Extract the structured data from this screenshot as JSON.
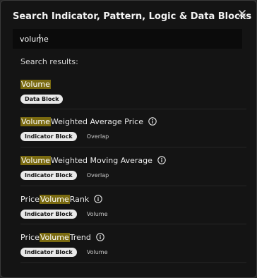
{
  "modal": {
    "title": "Search Indicator, Pattern, Logic & Data Blocks",
    "close_icon": "close-icon"
  },
  "search": {
    "value": "volume",
    "placeholder": ""
  },
  "results_label": "Search results:",
  "highlight_color": "#7a6a10",
  "results": [
    {
      "pre": "",
      "match": "Volume",
      "post": "",
      "info": false,
      "badge": "Data Block",
      "meta": ""
    },
    {
      "pre": "",
      "match": "Volume",
      "post": " Weighted Average Price",
      "info": true,
      "badge": "Indicator Block",
      "meta": "Overlap"
    },
    {
      "pre": "",
      "match": "Volume",
      "post": " Weighted Moving Average",
      "info": true,
      "badge": "Indicator Block",
      "meta": "Overlap"
    },
    {
      "pre": "Price ",
      "match": "Volume",
      "post": " Rank",
      "info": true,
      "badge": "Indicator Block",
      "meta": "Volume"
    },
    {
      "pre": "Price ",
      "match": "Volume",
      "post": " Trend",
      "info": true,
      "badge": "Indicator Block",
      "meta": "Volume"
    }
  ]
}
